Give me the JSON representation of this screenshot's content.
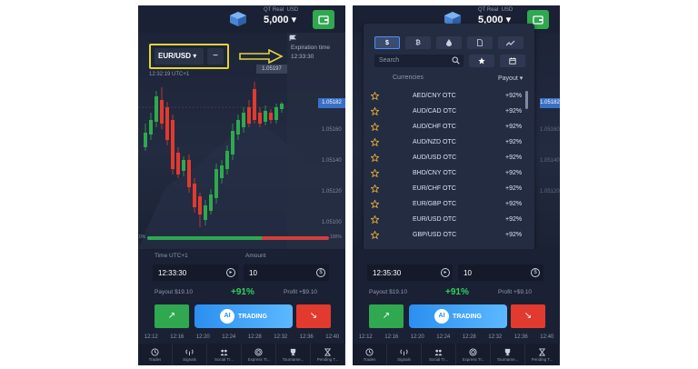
{
  "account": {
    "type": "QT Real",
    "currency": "USD",
    "balance": "5,000"
  },
  "left": {
    "pair": "EUR/USD",
    "clock": "12:32:19 UTC+1",
    "expiration": {
      "title": "Expiration time",
      "time": "12:33:30"
    },
    "price_tag_current": "1.05182",
    "price_tag_other": "1.05197",
    "y_axis": [
      "1.05160",
      "1.05140",
      "1.05120",
      "1.05100"
    ],
    "progress": {
      "value_pct": 63,
      "left_label": "0%",
      "right_label": "100%"
    },
    "time_label": "Time UTC+1",
    "time_value": "12:33:30",
    "amount_label": "Amount",
    "amount_value": "10",
    "payout_label": "Payout",
    "payout_value": "$19.10",
    "payout_pct": "+91%",
    "profit_label": "Profit",
    "profit_value": "+$9.10",
    "ai_label": "AI",
    "ai_button": "TRADING"
  },
  "right": {
    "categories": [
      "$",
      "₿",
      "",
      "",
      ""
    ],
    "search_placeholder": "Search",
    "list_header": "Currencies",
    "sort_label": "Payout",
    "pairs": [
      {
        "name": "AED/CNY OTC",
        "payout": "+92%"
      },
      {
        "name": "AUD/CAD OTC",
        "payout": "+92%"
      },
      {
        "name": "AUD/CHF OTC",
        "payout": "+92%"
      },
      {
        "name": "AUD/NZD OTC",
        "payout": "+92%"
      },
      {
        "name": "AUD/USD OTC",
        "payout": "+92%"
      },
      {
        "name": "BHD/CNY OTC",
        "payout": "+92%"
      },
      {
        "name": "EUR/CHF OTC",
        "payout": "+92%"
      },
      {
        "name": "EUR/GBP OTC",
        "payout": "+92%"
      },
      {
        "name": "EUR/USD OTC",
        "payout": "+92%"
      },
      {
        "name": "GBP/USD OTC",
        "payout": "+92%"
      }
    ],
    "side_axis": [
      "1.05182",
      "1.05160",
      "1.05140",
      "1.05120"
    ],
    "time_value": "12:35:30",
    "amount_value": "10",
    "payout_label": "Payout",
    "payout_value": "$19.10",
    "payout_pct": "+91%",
    "profit_label": "Profit",
    "profit_value": "+$9.10",
    "ai_label": "AI",
    "ai_button": "TRADING"
  },
  "time_axis": [
    "12:12",
    "12:16",
    "12:20",
    "12:24",
    "12:28",
    "12:32",
    "12:36",
    "12:40"
  ],
  "nav": [
    "Trades",
    "Signals",
    "Social Tr...",
    "Express Tr...",
    "Tourname...",
    "Pending T..."
  ],
  "colors": {
    "bg": "#1d2438",
    "up": "#2fa84f",
    "down": "#e23a2e",
    "accent": "#3a6fc6",
    "highlight": "#e2d43a"
  }
}
